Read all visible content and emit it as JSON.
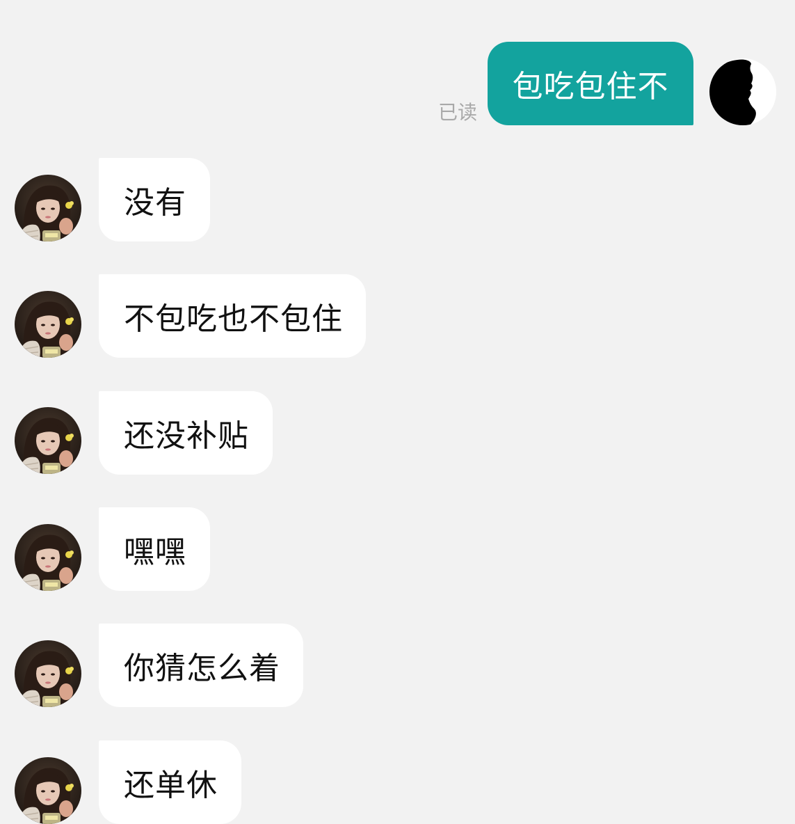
{
  "conversation": {
    "outgoing": {
      "text": "包吃包住不",
      "status": "已读"
    },
    "incoming": [
      {
        "text": "没有"
      },
      {
        "text": "不包吃也不包住"
      },
      {
        "text": "还没补贴"
      },
      {
        "text": "嘿嘿"
      },
      {
        "text": "你猜怎么着"
      },
      {
        "text": "还单休"
      }
    ]
  },
  "colors": {
    "background": "#f2f2f2",
    "outgoing_bubble": "#13a39e",
    "incoming_bubble": "#ffffff",
    "read_status": "#a9a9a9"
  },
  "icons": {
    "self_avatar": "silhouette-profile-avatar",
    "contact_avatar": "girl-photo-avatar"
  }
}
